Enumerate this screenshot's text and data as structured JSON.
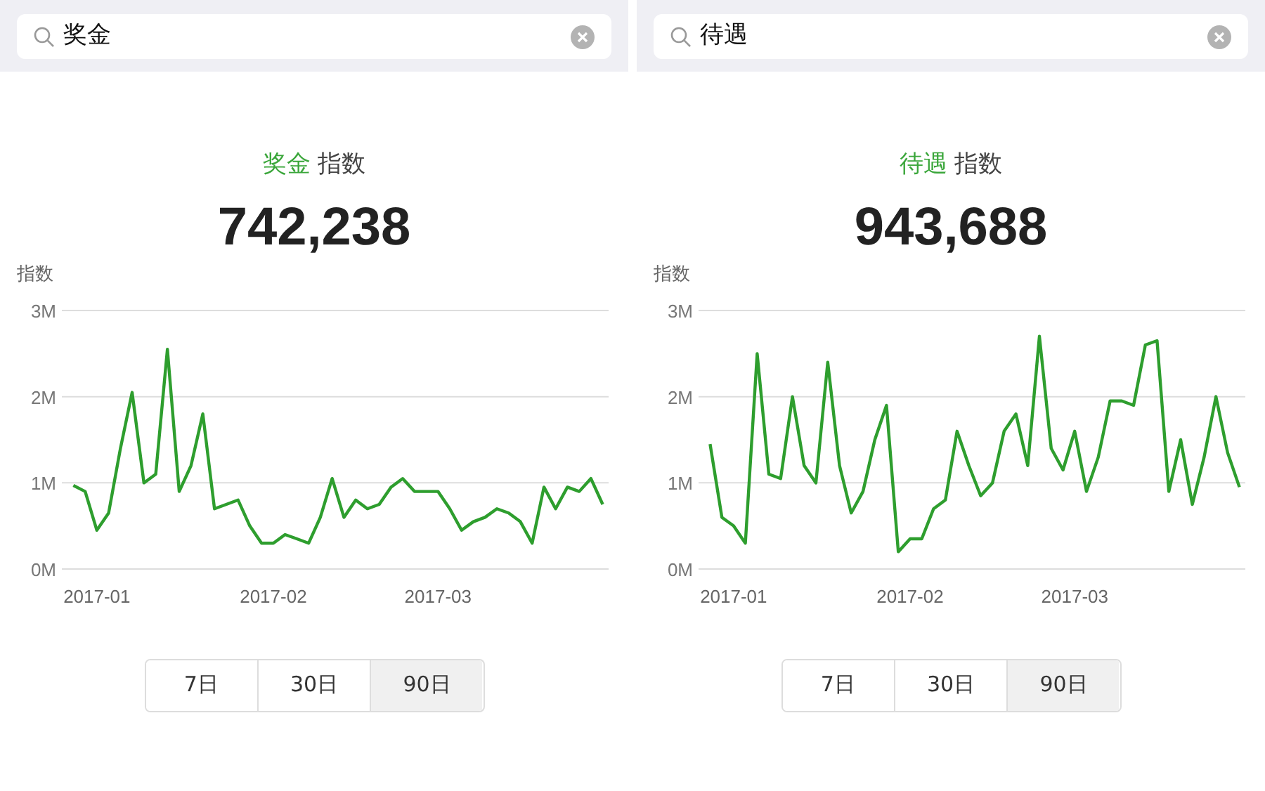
{
  "panels": [
    {
      "search": {
        "value": "奖金"
      },
      "title": {
        "keyword": "奖金",
        "suffix": "指数"
      },
      "index_value": "742,238",
      "chart_data": {
        "type": "line",
        "ylabel": "指数",
        "ylim": [
          0,
          3000000
        ],
        "categories": [
          null,
          null,
          "2017-01",
          null,
          null,
          null,
          null,
          null,
          null,
          null,
          null,
          null,
          null,
          null,
          null,
          null,
          null,
          "2017-02",
          null,
          null,
          null,
          null,
          null,
          null,
          null,
          null,
          null,
          null,
          null,
          null,
          null,
          "2017-03",
          null,
          null,
          null,
          null,
          null,
          null,
          null,
          null,
          null,
          null,
          null,
          null,
          null,
          null
        ],
        "yticks": [
          {
            "value": 0,
            "label": "0M"
          },
          {
            "value": 1000000,
            "label": "1M"
          },
          {
            "value": 2000000,
            "label": "2M"
          },
          {
            "value": 3000000,
            "label": "3M"
          }
        ],
        "series": [
          {
            "color": "#2e9e2e",
            "values": [
              970000,
              900000,
              450000,
              650000,
              1400000,
              2050000,
              1000000,
              1100000,
              2550000,
              900000,
              1200000,
              1800000,
              700000,
              750000,
              800000,
              500000,
              300000,
              300000,
              400000,
              350000,
              300000,
              600000,
              1050000,
              600000,
              800000,
              700000,
              750000,
              950000,
              1050000,
              900000,
              900000,
              900000,
              700000,
              450000,
              550000,
              600000,
              700000,
              650000,
              550000,
              300000,
              950000,
              700000,
              950000,
              900000,
              1050000,
              750000
            ]
          }
        ]
      },
      "ranges": [
        {
          "label": "7日",
          "selected": false
        },
        {
          "label": "30日",
          "selected": false
        },
        {
          "label": "90日",
          "selected": true
        }
      ]
    },
    {
      "search": {
        "value": "待遇"
      },
      "title": {
        "keyword": "待遇",
        "suffix": "指数"
      },
      "index_value": "943,688",
      "chart_data": {
        "type": "line",
        "ylabel": "指数",
        "ylim": [
          0,
          3000000
        ],
        "categories": [
          null,
          null,
          "2017-01",
          null,
          null,
          null,
          null,
          null,
          null,
          null,
          null,
          null,
          null,
          null,
          null,
          null,
          null,
          "2017-02",
          null,
          null,
          null,
          null,
          null,
          null,
          null,
          null,
          null,
          null,
          null,
          null,
          null,
          "2017-03",
          null,
          null,
          null,
          null,
          null,
          null,
          null,
          null,
          null,
          null,
          null,
          null,
          null,
          null
        ],
        "yticks": [
          {
            "value": 0,
            "label": "0M"
          },
          {
            "value": 1000000,
            "label": "1M"
          },
          {
            "value": 2000000,
            "label": "2M"
          },
          {
            "value": 3000000,
            "label": "3M"
          }
        ],
        "series": [
          {
            "color": "#2e9e2e",
            "values": [
              1450000,
              600000,
              500000,
              300000,
              2500000,
              1100000,
              1050000,
              2000000,
              1200000,
              1000000,
              2400000,
              1200000,
              650000,
              900000,
              1500000,
              1900000,
              200000,
              350000,
              350000,
              700000,
              800000,
              1600000,
              1200000,
              850000,
              1000000,
              1600000,
              1800000,
              1200000,
              2700000,
              1400000,
              1150000,
              1600000,
              900000,
              1300000,
              1950000,
              1950000,
              1900000,
              2600000,
              2650000,
              900000,
              1500000,
              750000,
              1300000,
              2000000,
              1350000,
              950000
            ]
          }
        ]
      },
      "ranges": [
        {
          "label": "7日",
          "selected": false
        },
        {
          "label": "30日",
          "selected": false
        },
        {
          "label": "90日",
          "selected": true
        }
      ]
    }
  ]
}
